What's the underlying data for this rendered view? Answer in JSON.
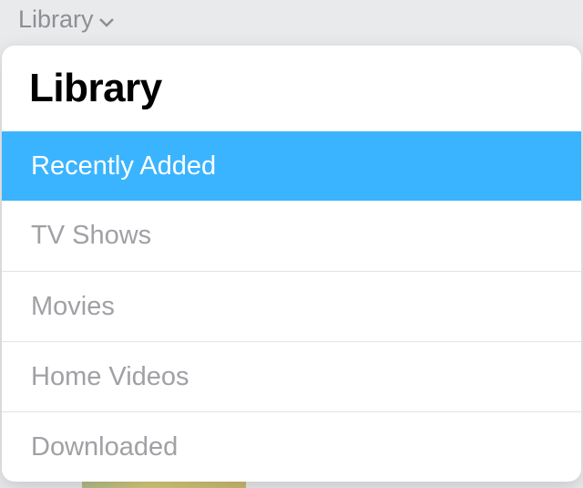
{
  "nav": {
    "label": "Library"
  },
  "popover": {
    "title": "Library",
    "items": [
      {
        "label": "Recently Added",
        "selected": true
      },
      {
        "label": "TV Shows",
        "selected": false
      },
      {
        "label": "Movies",
        "selected": false
      },
      {
        "label": "Home Videos",
        "selected": false
      },
      {
        "label": "Downloaded",
        "selected": false
      }
    ]
  }
}
